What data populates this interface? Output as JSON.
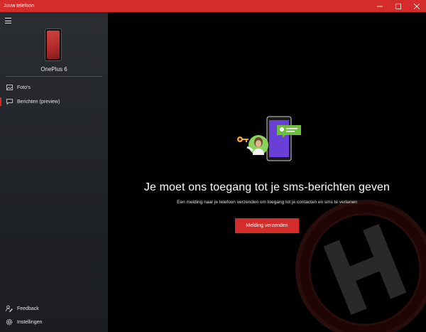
{
  "window": {
    "title": "Jouw telefoon",
    "controls": {
      "minimize_icon": "minimize-icon",
      "maximize_icon": "maximize-icon",
      "close_icon": "close-icon"
    },
    "accent_color": "#d42b2b"
  },
  "sidebar": {
    "menu_icon": "hamburger-icon",
    "device_name": "OnePlus 6",
    "items": [
      {
        "label": "Foto's",
        "icon": "photos-icon",
        "active": false
      },
      {
        "label": "Berichten (preview)",
        "icon": "messages-icon",
        "active": true
      }
    ],
    "bottom_items": [
      {
        "label": "Feedback",
        "icon": "feedback-icon"
      },
      {
        "label": "Instellingen",
        "icon": "gear-icon"
      }
    ]
  },
  "main": {
    "headline": "Je moet ons toegang tot je sms-berichten geven",
    "subline": "Een melding naar je telefoon verzenden om toegang tot je contacten en sms te verlenen",
    "button_label": "Melding verzenden"
  }
}
